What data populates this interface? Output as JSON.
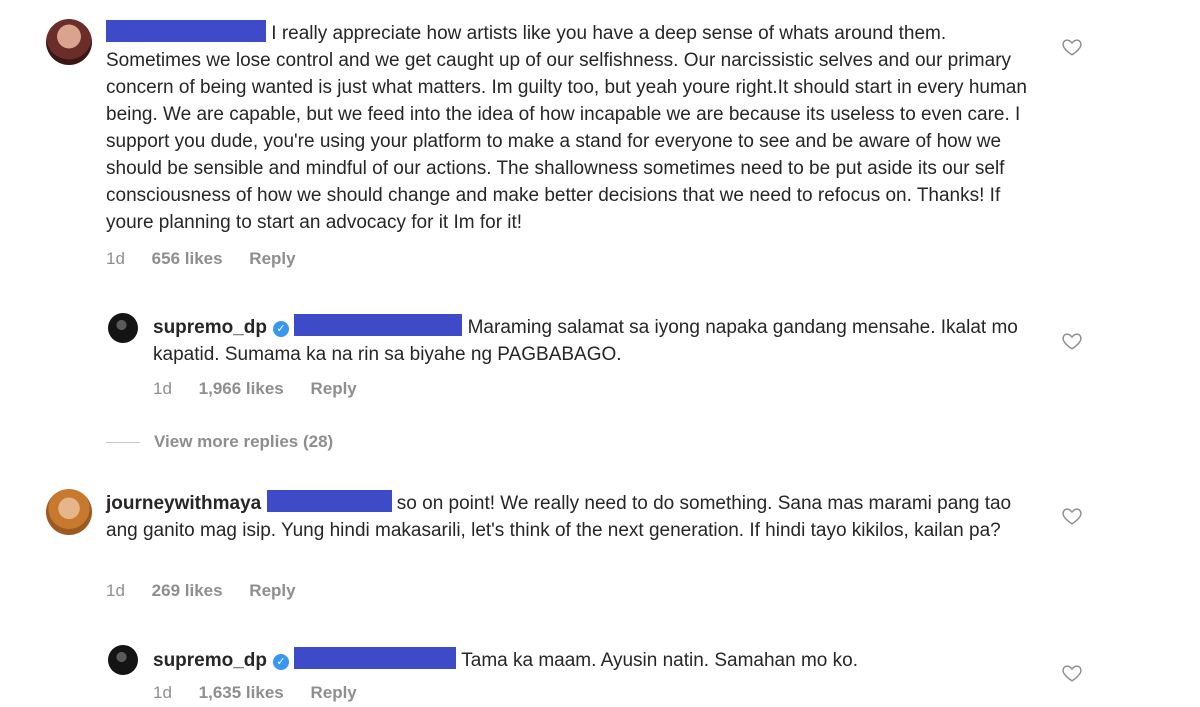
{
  "comments": [
    {
      "username": "",
      "text": "I really appreciate how artists like you have a deep sense of whats around them. Sometimes we lose control and we get caught up of our selfishness. Our narcissistic selves and our primary concern of being wanted is just what matters. Im guilty too, but yeah youre right.It should start in every human being. We are capable, but we feed into the idea of how incapable we are because its useless to even care. I support you dude, you're using your platform to make a stand for everyone to see and be aware of how we should be sensible and  mindful of our actions. The shallowness sometimes need to be put aside its our self consciousness  of how we should change and make better decisions that we need to refocus on. Thanks! If youre planning to start an advocacy for it Im for it!",
      "time": "1d",
      "likes": "656 likes",
      "reply_label": "Reply"
    },
    {
      "username": "supremo_dp",
      "verified": true,
      "text": "Maraming salamat sa iyong napaka gandang mensahe. Ikalat mo kapatid. Sumama ka na rin sa biyahe ng PAGBABAGO.",
      "time": "1d",
      "likes": "1,966 likes",
      "reply_label": "Reply"
    },
    {
      "username": "journeywithmaya",
      "text": "so on point! We really need to do something. Sana mas marami pang tao ang ganito mag isip. Yung hindi makasarili, let's think of the next generation. If hindi tayo kikilos, kailan pa?",
      "time": "1d",
      "likes": "269 likes",
      "reply_label": "Reply"
    },
    {
      "username": "supremo_dp",
      "verified": true,
      "text": "Tama ka maam. Ayusin natin. Samahan mo ko.",
      "time": "1d",
      "likes": "1,635 likes",
      "reply_label": "Reply"
    }
  ],
  "view_more_replies": "View more replies (28)",
  "icons": {
    "like": "heart-outline-icon",
    "verified": "verified-badge-icon",
    "verified_glyph": "✓"
  },
  "colors": {
    "redaction": "#3d4bc9",
    "verified": "#3897f0",
    "meta_text": "#8e8e8e",
    "text": "#262626"
  }
}
